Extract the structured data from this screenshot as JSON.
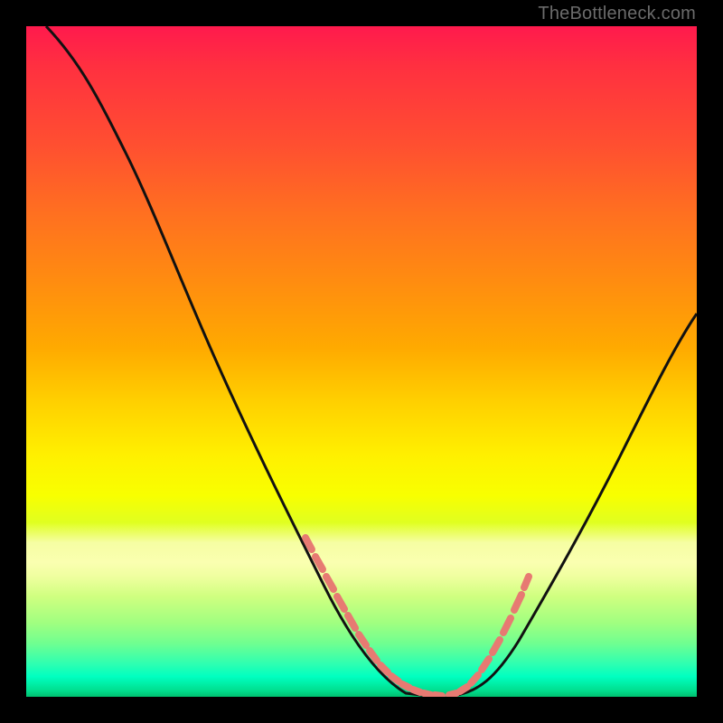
{
  "watermark": "TheBottleneck.com",
  "colors": {
    "frame": "#000000",
    "curve": "#111111",
    "dots": "#e77a72",
    "watermark": "#6b6b6b"
  },
  "chart_data": {
    "type": "line",
    "title": "",
    "xlabel": "",
    "ylabel": "",
    "xlim": [
      0,
      100
    ],
    "ylim": [
      0,
      100
    ],
    "grid": false,
    "legend": false,
    "series": [
      {
        "name": "left-curve",
        "x": [
          3,
          8,
          12,
          16,
          20,
          24,
          28,
          32,
          36,
          40,
          44,
          48,
          52,
          56,
          58
        ],
        "y": [
          100,
          96,
          90,
          83,
          75,
          66,
          56,
          46,
          36,
          27,
          19,
          12,
          7,
          3,
          1
        ]
      },
      {
        "name": "right-curve",
        "x": [
          66,
          69,
          72,
          75,
          78,
          81,
          84,
          87,
          90,
          93,
          96,
          99,
          100
        ],
        "y": [
          1,
          3,
          6,
          10,
          15,
          20,
          26,
          32,
          38,
          44,
          50,
          55,
          57
        ]
      },
      {
        "name": "highlight-dots",
        "x": [
          41.5,
          42.5,
          44.5,
          46,
          47.5,
          49,
          51,
          52.5,
          54,
          55.5,
          57,
          58.5,
          60,
          61.5,
          63,
          64,
          66,
          67.5,
          69,
          70,
          71.5,
          73
        ],
        "y": [
          24,
          22,
          19,
          16.5,
          14,
          11.5,
          9,
          7,
          5.5,
          4,
          3,
          2,
          1.5,
          1.2,
          1,
          1.2,
          1.8,
          3,
          5,
          8,
          11.5,
          16
        ]
      }
    ]
  }
}
